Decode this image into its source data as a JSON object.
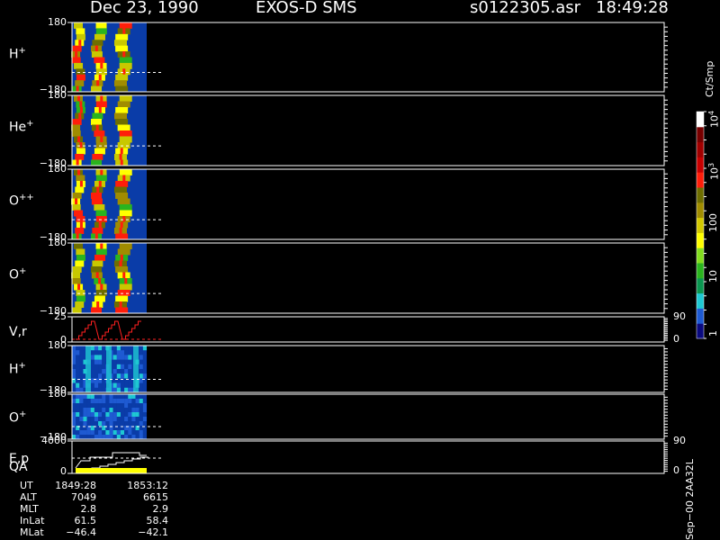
{
  "header": {
    "date": "Dec 23, 1990",
    "instrument": "EXOS-D SMS",
    "file": "s0122305.asr",
    "time": "18:49:28"
  },
  "panels": [
    {
      "name": "H",
      "sup": "+",
      "top": "180",
      "bottom": "−180"
    },
    {
      "name": "He",
      "sup": "+",
      "top": "180",
      "bottom": "−180"
    },
    {
      "name": "O",
      "sup": "++",
      "top": "180",
      "bottom": "−180"
    },
    {
      "name": "O",
      "sup": "+",
      "top": "180",
      "bottom": "−180"
    },
    {
      "name": "V,r",
      "sup": "",
      "top": "25",
      "bottom": "0",
      "right_top": "90",
      "right_bottom": "0"
    },
    {
      "name": "H",
      "sup": "+",
      "top": "180",
      "bottom": "−180"
    },
    {
      "name": "O",
      "sup": "+",
      "top": "180",
      "bottom": "−180"
    },
    {
      "name": "E,p",
      "sup": "",
      "top": "4000",
      "bottom": "0",
      "right_top": "90",
      "right_bottom": "0"
    }
  ],
  "qa_label": "QA",
  "colorbar": {
    "unit": "Ct/Smp",
    "labels": [
      {
        "base": "10",
        "exp": "4"
      },
      {
        "base": "10",
        "exp": "3"
      },
      {
        "base": "100",
        "exp": ""
      },
      {
        "base": "10",
        "exp": ""
      },
      {
        "base": "1",
        "exp": ""
      }
    ],
    "colors": [
      "#0a0a80",
      "#1e5ad2",
      "#1ec8d2",
      "#0a9650",
      "#2ab41e",
      "#82dc1e",
      "#ffff00",
      "#d2c800",
      "#a08c00",
      "#6e6e00",
      "#ff1e0a",
      "#c80000",
      "#a00000",
      "#780000",
      "#ffffff"
    ]
  },
  "footer_code": "Sep−00 2AA32L",
  "orbit_info": {
    "labels": [
      "UT",
      "ALT",
      "MLT",
      "InLat",
      "MLat"
    ],
    "col1": [
      "1849:28",
      "7049",
      "2.8",
      "61.5",
      "−46.4"
    ],
    "col2": [
      "1853:12",
      "6615",
      "2.9",
      "58.4",
      "−42.1"
    ]
  },
  "chart_data": {
    "type": "heatmap",
    "title": "Dec 23, 1990   EXOS-D SMS",
    "x": {
      "label": "UT",
      "ticks": [
        "1849:28",
        "1853:12"
      ]
    },
    "panels": [
      {
        "species": "H+",
        "ylim": [
          -180,
          180
        ]
      },
      {
        "species": "He+",
        "ylim": [
          -180,
          180
        ]
      },
      {
        "species": "O++",
        "ylim": [
          -180,
          180
        ]
      },
      {
        "species": "O+",
        "ylim": [
          -180,
          180
        ]
      },
      {
        "species": "V,r",
        "ylim": [
          0,
          25
        ],
        "y2lim": [
          0,
          90
        ]
      },
      {
        "species": "H+",
        "ylim": [
          -180,
          180
        ]
      },
      {
        "species": "O+",
        "ylim": [
          -180,
          180
        ]
      },
      {
        "species": "E,p",
        "ylim": [
          0,
          4000
        ],
        "y2lim": [
          0,
          90
        ]
      }
    ],
    "colorbar": {
      "unit": "Ct/Smp",
      "scale": "log",
      "range": [
        1,
        10000
      ]
    },
    "data_coverage_fraction": 0.12
  }
}
